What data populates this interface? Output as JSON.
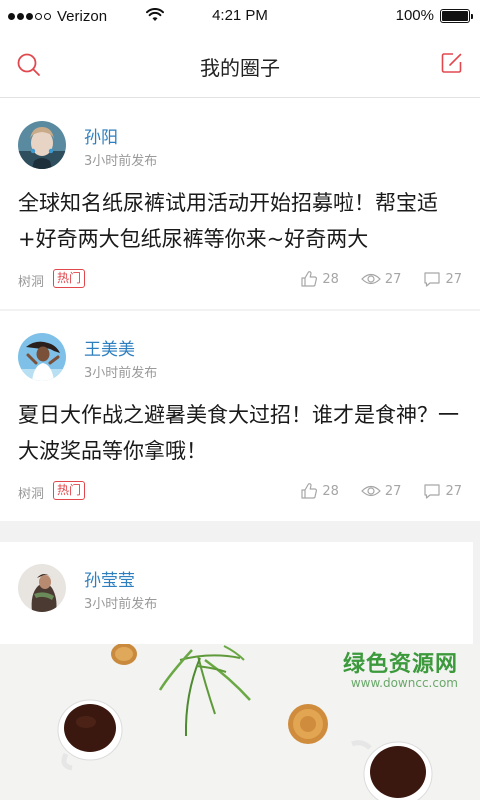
{
  "status_bar": {
    "carrier": "Verizon",
    "time": "4:21 PM",
    "battery": "100%",
    "battery_level": 1.0,
    "signal_bars_filled": 3,
    "signal_bars_total": 5
  },
  "nav": {
    "title": "我的圈子",
    "search_icon": "search-icon",
    "edit_icon": "compose-icon"
  },
  "posts": [
    {
      "author": "孙阳",
      "time": "3小时前发布",
      "text": "全球知名纸尿裤试用活动开始招募啦！帮宝适+好奇两大包纸尿裤等你来~好奇两大",
      "tag": "树洞",
      "badge": "热门",
      "likes": "28",
      "views": "27",
      "comments": "27"
    },
    {
      "author": "王美美",
      "time": "3小时前发布",
      "text": "夏日大作战之避暑美食大过招！谁才是食神？一大波奖品等你拿哦！",
      "tag": "树洞",
      "badge": "热门",
      "likes": "28",
      "views": "27",
      "comments": "27"
    },
    {
      "author": "孙莹莹",
      "time": "3小时前发布"
    }
  ],
  "watermark": {
    "title": "绿色资源网",
    "url": "www.downcc.com"
  },
  "colors": {
    "accent_red": "#e0484e",
    "author_blue": "#2e7fbf",
    "watermark_green": "#3c9a3c"
  }
}
